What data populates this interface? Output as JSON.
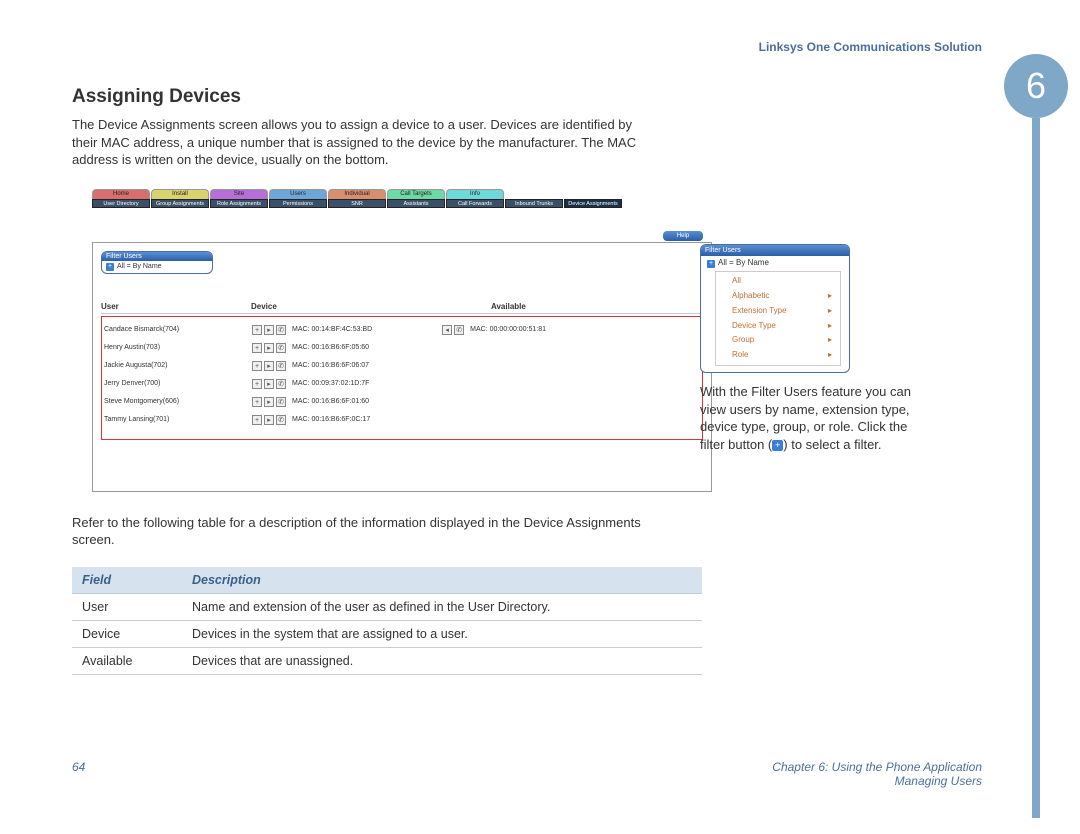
{
  "header": {
    "product": "Linksys One Communications Solution"
  },
  "chapter": {
    "number": "6"
  },
  "section": {
    "title": "Assigning Devices"
  },
  "paragraphs": {
    "p1": "The Device Assignments screen allows you to assign a device to a user. Devices are identified by their MAC address, a unique number that is assigned to the device by the manufacturer. The MAC address is written on the device, usually on the bottom.",
    "p2": "Refer to the following table for a description of the information displayed in the Device Assignments screen."
  },
  "tabs": {
    "top": [
      "Home",
      "Install",
      "Site",
      "Users",
      "Individual",
      "Call Targets",
      "Info"
    ],
    "colors": [
      "#d86f6f",
      "#d8d26f",
      "#b76fd8",
      "#6fa6d8",
      "#d88f6f",
      "#6fd8a6",
      "#6fd8d8"
    ],
    "sub": [
      "User Directory",
      "Group Assignments",
      "Role Assignments",
      "Permissions",
      "SNR",
      "Assistants",
      "Call Forwards",
      "Inbound Trunks",
      "Device Assignments"
    ]
  },
  "help_label": "Help",
  "filter": {
    "title": "Filter Users",
    "byname": "All = By Name",
    "menu": [
      "All",
      "Alphabetic",
      "Extension Type",
      "Device Type",
      "Group",
      "Role"
    ]
  },
  "cols": {
    "user": "User",
    "device": "Device",
    "available": "Available"
  },
  "users": [
    {
      "name": "Candace Bismarck(704)",
      "mac": "MAC: 00:14:BF:4C:53:BD"
    },
    {
      "name": "Henry Austin(703)",
      "mac": "MAC: 00:16:B6:6F:05:60"
    },
    {
      "name": "Jackie Augusta(702)",
      "mac": "MAC: 00:16:B6:6F:06:07"
    },
    {
      "name": "Jerry Denver(700)",
      "mac": "MAC: 00:09:37:02:1D:7F"
    },
    {
      "name": "Steve Montgomery(606)",
      "mac": "MAC: 00:16:B6:6F:01:60"
    },
    {
      "name": "Tammy Lansing(701)",
      "mac": "MAC: 00:16:B6:6F:0C:17"
    }
  ],
  "available_mac": "MAC: 00:00:00:00:51:81",
  "side_text": {
    "a": "With the Filter Users feature you can view users by name, extension type, device type, group, or role. Click the filter button (",
    "b": ") to select a filter."
  },
  "table": {
    "h1": "Field",
    "h2": "Description",
    "rows": [
      {
        "f": "User",
        "d": "Name and extension of the user as defined in the User Directory."
      },
      {
        "f": "Device",
        "d": "Devices in the system that are assigned to a user."
      },
      {
        "f": "Available",
        "d": "Devices that are unassigned."
      }
    ]
  },
  "footer": {
    "page": "64",
    "chapter": "Chapter 6: Using the Phone Application",
    "sub": "Managing Users"
  }
}
